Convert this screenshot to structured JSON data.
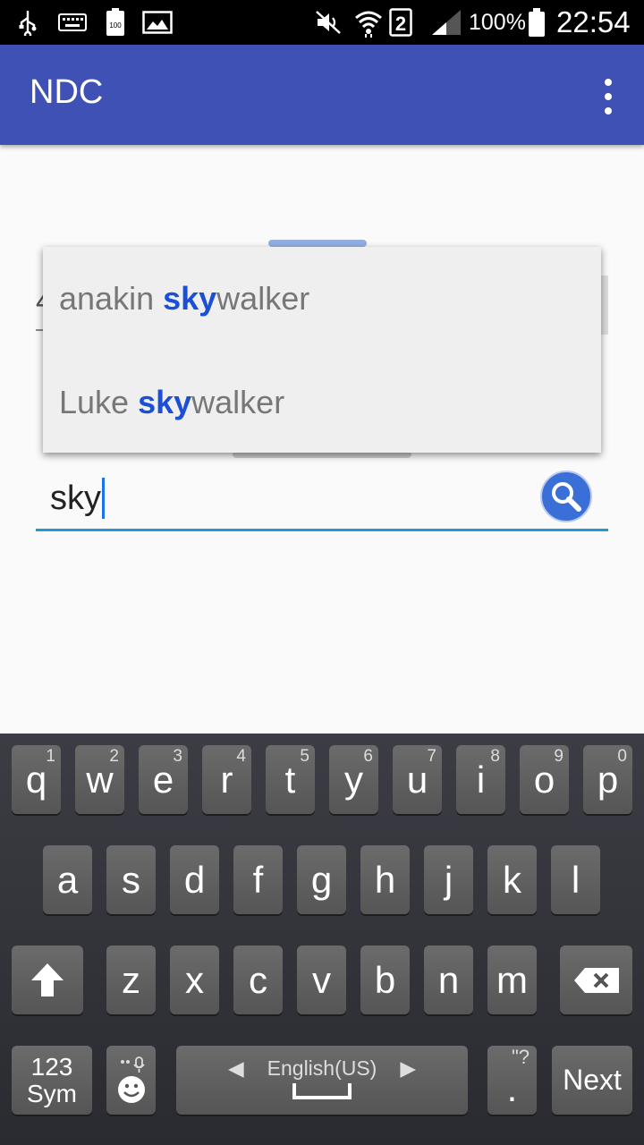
{
  "status_bar": {
    "battery_percent": "100%",
    "time": "22:54",
    "sim_badge": "2",
    "battery_badge": "100"
  },
  "app_bar": {
    "title": "NDC"
  },
  "background_field": {
    "partial_char": "4"
  },
  "search": {
    "value": "sky"
  },
  "suggestions": [
    {
      "prefix": "anakin ",
      "match": "sky",
      "suffix": "walker"
    },
    {
      "prefix": "Luke ",
      "match": "sky",
      "suffix": "walker"
    }
  ],
  "keyboard": {
    "row1": [
      {
        "label": "q",
        "hint": "1"
      },
      {
        "label": "w",
        "hint": "2"
      },
      {
        "label": "e",
        "hint": "3"
      },
      {
        "label": "r",
        "hint": "4"
      },
      {
        "label": "t",
        "hint": "5"
      },
      {
        "label": "y",
        "hint": "6"
      },
      {
        "label": "u",
        "hint": "7"
      },
      {
        "label": "i",
        "hint": "8"
      },
      {
        "label": "o",
        "hint": "9"
      },
      {
        "label": "p",
        "hint": "0"
      }
    ],
    "row2": [
      "a",
      "s",
      "d",
      "f",
      "g",
      "h",
      "j",
      "k",
      "l"
    ],
    "row3": [
      "z",
      "x",
      "c",
      "v",
      "b",
      "n",
      "m"
    ],
    "sym_line1": "123",
    "sym_line2": "Sym",
    "language": "English(US)",
    "period": ".",
    "period_hint": "\"?",
    "next": "Next"
  }
}
